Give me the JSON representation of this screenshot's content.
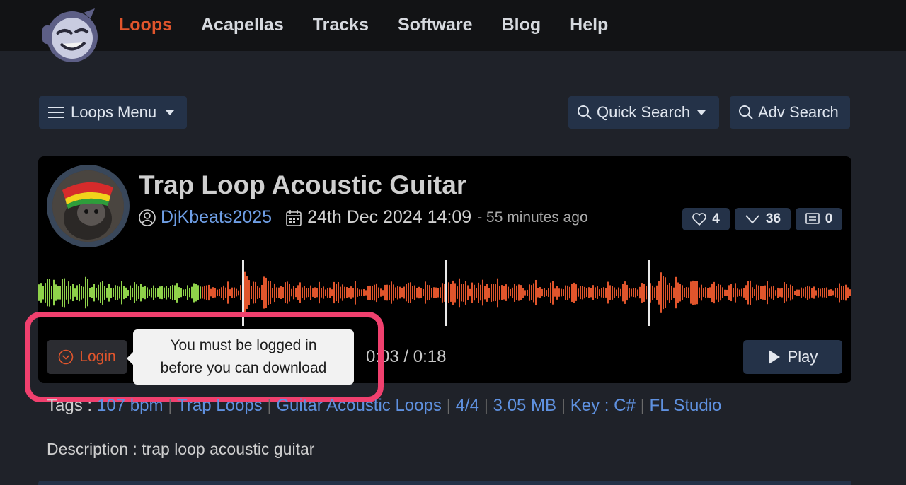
{
  "nav": {
    "items": [
      {
        "label": "Loops",
        "active": true
      },
      {
        "label": "Acapellas",
        "active": false
      },
      {
        "label": "Tracks",
        "active": false
      },
      {
        "label": "Software",
        "active": false
      },
      {
        "label": "Blog",
        "active": false
      },
      {
        "label": "Help",
        "active": false
      }
    ]
  },
  "toolbar": {
    "loops_menu_label": "Loops Menu",
    "quick_search_label": "Quick Search",
    "adv_search_label": "Adv Search"
  },
  "loop": {
    "title": "Trap Loop Acoustic Guitar",
    "user": "DjKbeats2025",
    "date": "24th Dec 2024 14:09",
    "ago": "- 55 minutes ago",
    "likes": "4",
    "downloads": "36",
    "comments": "0"
  },
  "player": {
    "login_label": "Login",
    "tooltip_line1": "You must be logged in",
    "tooltip_line2": "before you can download",
    "time": "0:03 / 0:18",
    "play_label": "Play",
    "progress": 0.2
  },
  "tags": {
    "label": "Tags :",
    "items": [
      "107 bpm",
      "Trap Loops",
      "Guitar Acoustic Loops",
      "4/4",
      "3.05 MB",
      "Key : C#",
      "FL Studio"
    ]
  },
  "description": "Description : trap loop acoustic guitar",
  "colors": {
    "accent": "#e0552c",
    "played_wave": "#8fd24a",
    "unplayed_wave": "#e0552c",
    "link": "#5f91e0",
    "highlight": "#f0406e",
    "button_bg": "#243248"
  }
}
